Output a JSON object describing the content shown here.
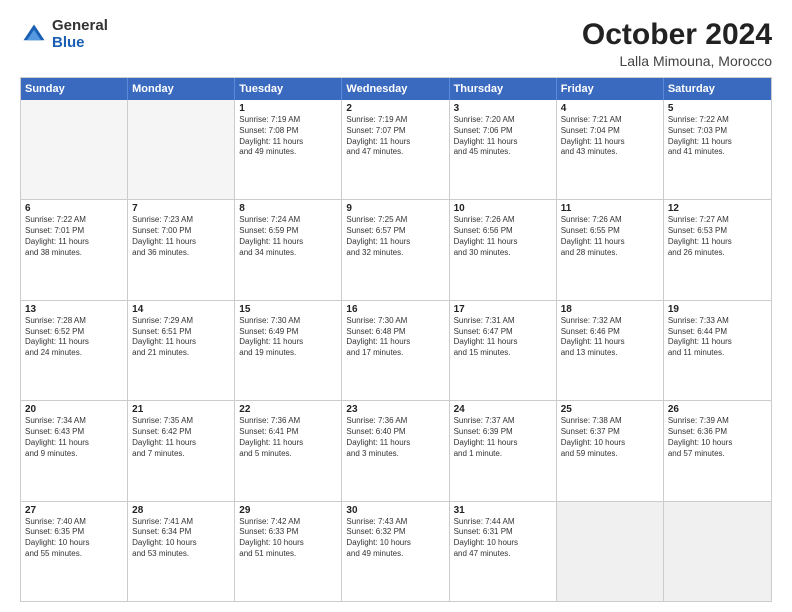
{
  "logo": {
    "general": "General",
    "blue": "Blue"
  },
  "header": {
    "month": "October 2024",
    "location": "Lalla Mimouna, Morocco"
  },
  "weekdays": [
    "Sunday",
    "Monday",
    "Tuesday",
    "Wednesday",
    "Thursday",
    "Friday",
    "Saturday"
  ],
  "rows": [
    [
      {
        "day": "",
        "empty": true
      },
      {
        "day": "",
        "empty": true
      },
      {
        "day": "1",
        "lines": [
          "Sunrise: 7:19 AM",
          "Sunset: 7:08 PM",
          "Daylight: 11 hours",
          "and 49 minutes."
        ]
      },
      {
        "day": "2",
        "lines": [
          "Sunrise: 7:19 AM",
          "Sunset: 7:07 PM",
          "Daylight: 11 hours",
          "and 47 minutes."
        ]
      },
      {
        "day": "3",
        "lines": [
          "Sunrise: 7:20 AM",
          "Sunset: 7:06 PM",
          "Daylight: 11 hours",
          "and 45 minutes."
        ]
      },
      {
        "day": "4",
        "lines": [
          "Sunrise: 7:21 AM",
          "Sunset: 7:04 PM",
          "Daylight: 11 hours",
          "and 43 minutes."
        ]
      },
      {
        "day": "5",
        "lines": [
          "Sunrise: 7:22 AM",
          "Sunset: 7:03 PM",
          "Daylight: 11 hours",
          "and 41 minutes."
        ]
      }
    ],
    [
      {
        "day": "6",
        "lines": [
          "Sunrise: 7:22 AM",
          "Sunset: 7:01 PM",
          "Daylight: 11 hours",
          "and 38 minutes."
        ]
      },
      {
        "day": "7",
        "lines": [
          "Sunrise: 7:23 AM",
          "Sunset: 7:00 PM",
          "Daylight: 11 hours",
          "and 36 minutes."
        ]
      },
      {
        "day": "8",
        "lines": [
          "Sunrise: 7:24 AM",
          "Sunset: 6:59 PM",
          "Daylight: 11 hours",
          "and 34 minutes."
        ]
      },
      {
        "day": "9",
        "lines": [
          "Sunrise: 7:25 AM",
          "Sunset: 6:57 PM",
          "Daylight: 11 hours",
          "and 32 minutes."
        ]
      },
      {
        "day": "10",
        "lines": [
          "Sunrise: 7:26 AM",
          "Sunset: 6:56 PM",
          "Daylight: 11 hours",
          "and 30 minutes."
        ]
      },
      {
        "day": "11",
        "lines": [
          "Sunrise: 7:26 AM",
          "Sunset: 6:55 PM",
          "Daylight: 11 hours",
          "and 28 minutes."
        ]
      },
      {
        "day": "12",
        "lines": [
          "Sunrise: 7:27 AM",
          "Sunset: 6:53 PM",
          "Daylight: 11 hours",
          "and 26 minutes."
        ]
      }
    ],
    [
      {
        "day": "13",
        "lines": [
          "Sunrise: 7:28 AM",
          "Sunset: 6:52 PM",
          "Daylight: 11 hours",
          "and 24 minutes."
        ]
      },
      {
        "day": "14",
        "lines": [
          "Sunrise: 7:29 AM",
          "Sunset: 6:51 PM",
          "Daylight: 11 hours",
          "and 21 minutes."
        ]
      },
      {
        "day": "15",
        "lines": [
          "Sunrise: 7:30 AM",
          "Sunset: 6:49 PM",
          "Daylight: 11 hours",
          "and 19 minutes."
        ]
      },
      {
        "day": "16",
        "lines": [
          "Sunrise: 7:30 AM",
          "Sunset: 6:48 PM",
          "Daylight: 11 hours",
          "and 17 minutes."
        ]
      },
      {
        "day": "17",
        "lines": [
          "Sunrise: 7:31 AM",
          "Sunset: 6:47 PM",
          "Daylight: 11 hours",
          "and 15 minutes."
        ]
      },
      {
        "day": "18",
        "lines": [
          "Sunrise: 7:32 AM",
          "Sunset: 6:46 PM",
          "Daylight: 11 hours",
          "and 13 minutes."
        ]
      },
      {
        "day": "19",
        "lines": [
          "Sunrise: 7:33 AM",
          "Sunset: 6:44 PM",
          "Daylight: 11 hours",
          "and 11 minutes."
        ]
      }
    ],
    [
      {
        "day": "20",
        "lines": [
          "Sunrise: 7:34 AM",
          "Sunset: 6:43 PM",
          "Daylight: 11 hours",
          "and 9 minutes."
        ]
      },
      {
        "day": "21",
        "lines": [
          "Sunrise: 7:35 AM",
          "Sunset: 6:42 PM",
          "Daylight: 11 hours",
          "and 7 minutes."
        ]
      },
      {
        "day": "22",
        "lines": [
          "Sunrise: 7:36 AM",
          "Sunset: 6:41 PM",
          "Daylight: 11 hours",
          "and 5 minutes."
        ]
      },
      {
        "day": "23",
        "lines": [
          "Sunrise: 7:36 AM",
          "Sunset: 6:40 PM",
          "Daylight: 11 hours",
          "and 3 minutes."
        ]
      },
      {
        "day": "24",
        "lines": [
          "Sunrise: 7:37 AM",
          "Sunset: 6:39 PM",
          "Daylight: 11 hours",
          "and 1 minute."
        ]
      },
      {
        "day": "25",
        "lines": [
          "Sunrise: 7:38 AM",
          "Sunset: 6:37 PM",
          "Daylight: 10 hours",
          "and 59 minutes."
        ]
      },
      {
        "day": "26",
        "lines": [
          "Sunrise: 7:39 AM",
          "Sunset: 6:36 PM",
          "Daylight: 10 hours",
          "and 57 minutes."
        ]
      }
    ],
    [
      {
        "day": "27",
        "lines": [
          "Sunrise: 7:40 AM",
          "Sunset: 6:35 PM",
          "Daylight: 10 hours",
          "and 55 minutes."
        ]
      },
      {
        "day": "28",
        "lines": [
          "Sunrise: 7:41 AM",
          "Sunset: 6:34 PM",
          "Daylight: 10 hours",
          "and 53 minutes."
        ]
      },
      {
        "day": "29",
        "lines": [
          "Sunrise: 7:42 AM",
          "Sunset: 6:33 PM",
          "Daylight: 10 hours",
          "and 51 minutes."
        ]
      },
      {
        "day": "30",
        "lines": [
          "Sunrise: 7:43 AM",
          "Sunset: 6:32 PM",
          "Daylight: 10 hours",
          "and 49 minutes."
        ]
      },
      {
        "day": "31",
        "lines": [
          "Sunrise: 7:44 AM",
          "Sunset: 6:31 PM",
          "Daylight: 10 hours",
          "and 47 minutes."
        ]
      },
      {
        "day": "",
        "empty": true,
        "shaded": true
      },
      {
        "day": "",
        "empty": true,
        "shaded": true
      }
    ]
  ]
}
